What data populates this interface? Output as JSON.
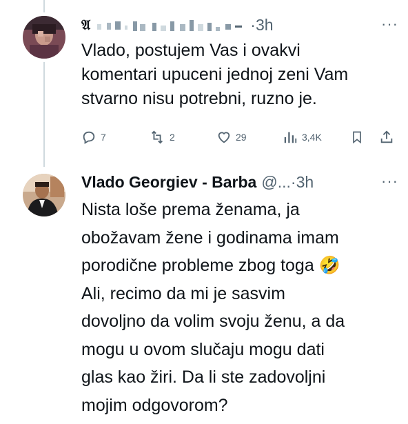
{
  "tweets": [
    {
      "author_name": "",
      "author_handle_initial": "𝔄",
      "time": "3h",
      "more_label": "···",
      "lines": [
        "Vlado, postujem Vas i ovakvi",
        "komentari upuceni jednoj zeni Vam",
        "stvarno nisu potrebni, ruzno je."
      ],
      "metrics": {
        "replies": "7",
        "reposts": "2",
        "likes": "29",
        "views": "3,4K"
      }
    },
    {
      "author_name": "Vlado Georgiev - Barba",
      "author_handle": "@...",
      "time": "3h",
      "more_label": "···",
      "lines": [
        "Nista loše prema ženama, ja",
        "obožavam žene i godinama imam",
        "porodične probleme zbog toga 🤣",
        "Ali, recimo da mi je sasvim",
        "dovoljno da volim svoju ženu, a da",
        "mogu u ovom slučaju mogu dati",
        "glas kao žiri. Da li ste zadovoljni",
        "mojim odgovorom?"
      ]
    }
  ],
  "icons": {
    "reply": "reply-icon",
    "repost": "repost-icon",
    "like": "heart-icon",
    "views": "views-icon",
    "bookmark": "bookmark-icon",
    "share": "share-icon"
  },
  "colors": {
    "text": "#0f1419",
    "secondary": "#536471",
    "thread_line": "#cfd9de"
  }
}
